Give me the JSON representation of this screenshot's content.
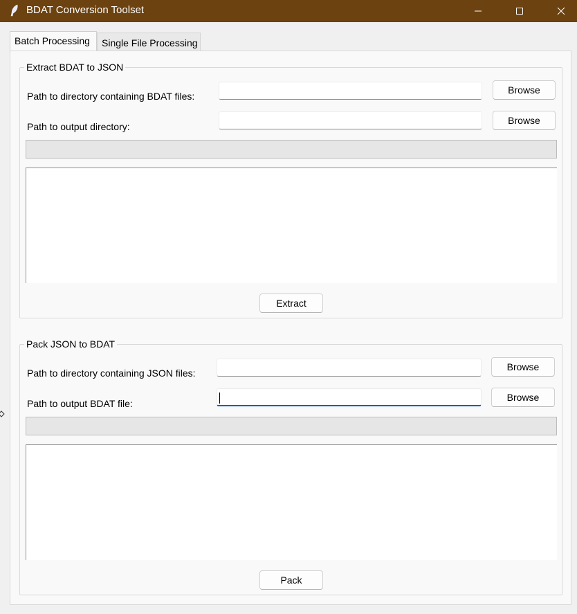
{
  "window": {
    "title": "BDAT Conversion Toolset",
    "icon": "feather-icon",
    "titlebar_color": "#6b4210"
  },
  "tabs": [
    {
      "label": "Batch Processing",
      "active": true
    },
    {
      "label": "Single File Processing",
      "active": false
    }
  ],
  "extract": {
    "legend": "Extract BDAT to JSON",
    "input_dir_label": "Path to directory containing BDAT files:",
    "input_dir_value": "",
    "output_dir_label": "Path to output directory:",
    "output_dir_value": "",
    "browse_label": "Browse",
    "progress": 0,
    "log_text": "",
    "action_label": "Extract"
  },
  "pack": {
    "legend": "Pack JSON to BDAT",
    "input_dir_label": "Path to directory containing JSON files:",
    "input_dir_value": "",
    "output_file_label": "Path to output BDAT file:",
    "output_file_value": "",
    "browse_label": "Browse",
    "progress": 0,
    "log_text": "",
    "action_label": "Pack"
  },
  "colors": {
    "accent": "#005fb8"
  }
}
